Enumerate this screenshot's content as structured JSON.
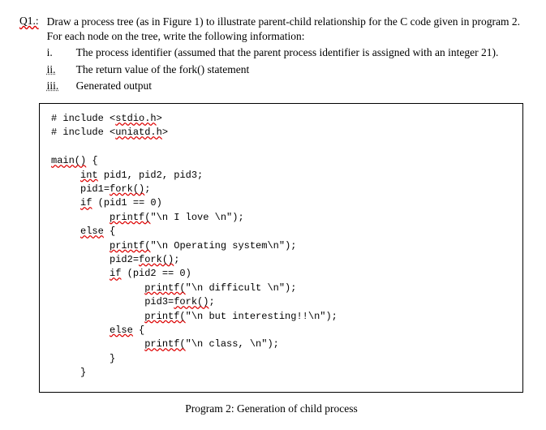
{
  "question": {
    "label": "Q1.:",
    "text": "Draw a process tree (as in Figure 1) to illustrate parent-child relationship for the C code given in program 2.  For each node on the tree, write the following information:",
    "items": [
      {
        "bullet": "i.",
        "text": "The process identifier (assumed that the parent process identifier is assigned with an integer 21)."
      },
      {
        "bullet": "ii.",
        "text": "The return value of the fork() statement"
      },
      {
        "bullet": "iii.",
        "text": "Generated output"
      }
    ]
  },
  "code": {
    "line1_seg1": "# include <",
    "line1_seg2": "stdio.h",
    "line1_seg3": ">",
    "line2_seg1": "# include <",
    "line2_seg2": "uniatd.h",
    "line2_seg3": ">",
    "main": "main()",
    "brace_open": " {",
    "decl_int": "int",
    "decl_rest": " pid1, pid2, pid3;",
    "pid1_assign_a": "pid1=",
    "pid1_assign_b": "fork()",
    "pid1_assign_c": ";",
    "if1_a": "if",
    "if1_b": " (pid1 == 0)",
    "printf1_a": "printf(",
    "printf1_b": "\"\\n I love \\n\");",
    "else1": "else",
    "else1_brace": " {",
    "printf2_a": "printf(",
    "printf2_b": "\"\\n Operating system\\n\");",
    "pid2_assign_a": "pid2=",
    "pid2_assign_b": "fork()",
    "pid2_assign_c": ";",
    "if2_a": "if",
    "if2_b": " (pid2 == 0)",
    "printf3_a": "printf(",
    "printf3_b": "\"\\n difficult \\n\");",
    "pid3_assign_a": "pid3=",
    "pid3_assign_b": "fork()",
    "pid3_assign_c": ";",
    "printf4_a": "printf(",
    "printf4_b": "\"\\n but interesting!!\\n\");",
    "else2": "else",
    "else2_brace": " {",
    "printf5_a": "printf(",
    "printf5_b": "\"\\n class, \\n\");",
    "brace_close1": "}",
    "brace_close2": "}"
  },
  "caption": "Program 2: Generation of child process"
}
